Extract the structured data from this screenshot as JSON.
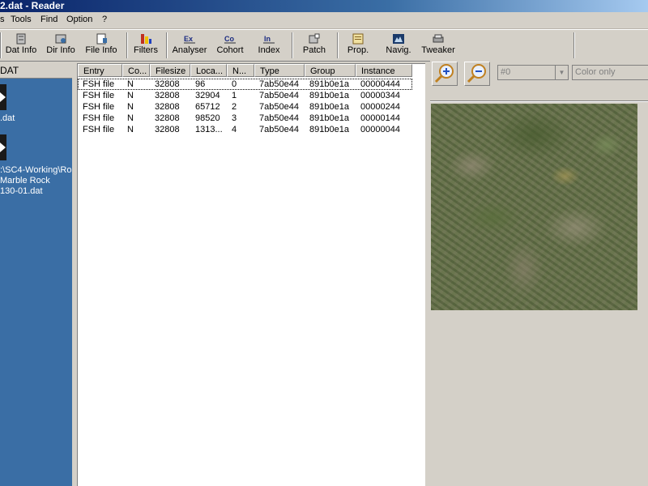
{
  "window": {
    "title": "2.dat - Reader"
  },
  "menu": {
    "items": [
      "s",
      "Tools",
      "Find",
      "Option",
      "?"
    ]
  },
  "toolbar": {
    "buttons": [
      {
        "label": "Dat Info",
        "icon": "dat-info-icon"
      },
      {
        "label": "Dir Info",
        "icon": "dir-info-icon"
      },
      {
        "label": "File Info",
        "icon": "file-info-icon"
      },
      {
        "label": "Filters",
        "icon": "filters-icon"
      },
      {
        "label": "Analyser",
        "icon": "analyser-icon"
      },
      {
        "label": "Cohort",
        "icon": "cohort-icon"
      },
      {
        "label": "Index",
        "icon": "index-icon"
      },
      {
        "label": "Patch",
        "icon": "patch-icon"
      },
      {
        "label": "Prop.",
        "icon": "properties-icon"
      },
      {
        "label": "Navig.",
        "icon": "navigator-icon"
      },
      {
        "label": "Tweaker",
        "icon": "tweaker-icon"
      }
    ]
  },
  "left": {
    "header": "DAT",
    "items": [
      {
        "label_lines": [
          ".dat"
        ]
      },
      {
        "label_lines": [
          ":\\SC4-Working\\Ro",
          "Marble Rock",
          "130-01.dat"
        ]
      }
    ]
  },
  "list": {
    "columns": [
      "Entry",
      "Co...",
      "Filesize",
      "Loca...",
      "N...",
      "Type",
      "Group",
      "Instance"
    ],
    "rows": [
      [
        "FSH file",
        "N",
        "32808",
        "96",
        "0",
        "7ab50e44",
        "891b0e1a",
        "00000444"
      ],
      [
        "FSH file",
        "N",
        "32808",
        "32904",
        "1",
        "7ab50e44",
        "891b0e1a",
        "00000344"
      ],
      [
        "FSH file",
        "N",
        "32808",
        "65712",
        "2",
        "7ab50e44",
        "891b0e1a",
        "00000244"
      ],
      [
        "FSH file",
        "N",
        "32808",
        "98520",
        "3",
        "7ab50e44",
        "891b0e1a",
        "00000144"
      ],
      [
        "FSH file",
        "N",
        "32808",
        "1313...",
        "4",
        "7ab50e44",
        "891b0e1a",
        "00000044"
      ]
    ]
  },
  "preview": {
    "zoom_in_icon": "zoom-in-icon",
    "zoom_out_icon": "zoom-out-icon",
    "bitmap_select": "#0",
    "color_mode": "Color only"
  }
}
